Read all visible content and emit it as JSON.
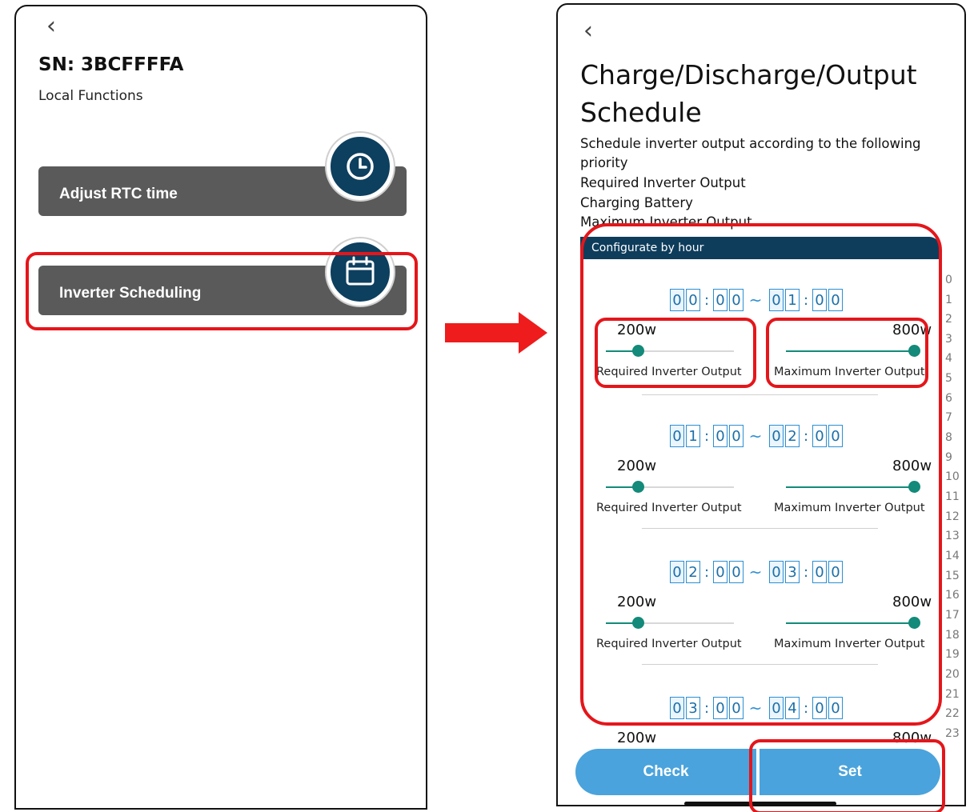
{
  "left_screen": {
    "back_symbol": "‹",
    "serial_title": "SN: 3BCFFFFA",
    "subtitle": "Local Functions",
    "cards": [
      {
        "label": "Adjust RTC time",
        "icon": "clock-icon"
      },
      {
        "label": "Inverter Scheduling",
        "icon": "calendar-icon"
      }
    ]
  },
  "arrow": {
    "color": "#ee1c1c",
    "icon": "right-arrow-icon"
  },
  "right_screen": {
    "back_symbol": "‹",
    "title": "Charge/Discharge/Output Schedule",
    "description_lines": [
      "Schedule inverter output according to the following",
      "priority",
      "Required Inverter Output",
      "Charging Battery",
      "Maximum Inverter Output"
    ],
    "configure_tab": "Configurate by hour",
    "slots": [
      {
        "start_h": [
          "0",
          "0"
        ],
        "start_m": [
          "0",
          "0"
        ],
        "end_h": [
          "0",
          "1"
        ],
        "end_m": [
          "0",
          "0"
        ],
        "required": "200w",
        "maximum": "800w",
        "required_label": "Required Inverter Output",
        "maximum_label": "Maximum Inverter Output",
        "required_level": 0.25,
        "maximum_level": 1.0
      },
      {
        "start_h": [
          "0",
          "1"
        ],
        "start_m": [
          "0",
          "0"
        ],
        "end_h": [
          "0",
          "2"
        ],
        "end_m": [
          "0",
          "0"
        ],
        "required": "200w",
        "maximum": "800w",
        "required_label": "Required Inverter Output",
        "maximum_label": "Maximum Inverter Output",
        "required_level": 0.25,
        "maximum_level": 1.0
      },
      {
        "start_h": [
          "0",
          "2"
        ],
        "start_m": [
          "0",
          "0"
        ],
        "end_h": [
          "0",
          "3"
        ],
        "end_m": [
          "0",
          "0"
        ],
        "required": "200w",
        "maximum": "800w",
        "required_label": "Required Inverter Output",
        "maximum_label": "Maximum Inverter Output",
        "required_level": 0.25,
        "maximum_level": 1.0
      },
      {
        "start_h": [
          "0",
          "3"
        ],
        "start_m": [
          "0",
          "0"
        ],
        "end_h": [
          "0",
          "4"
        ],
        "end_m": [
          "0",
          "0"
        ],
        "required": "200w",
        "maximum": "800w"
      }
    ],
    "hour_index": [
      "0",
      "1",
      "2",
      "3",
      "4",
      "5",
      "6",
      "7",
      "8",
      "9",
      "10",
      "11",
      "12",
      "13",
      "14",
      "15",
      "16",
      "17",
      "18",
      "19",
      "20",
      "21",
      "22",
      "23"
    ],
    "check_label": "Check",
    "set_label": "Set"
  },
  "colors": {
    "card_gray": "#5a5a5a",
    "badge_navy": "#0d3f5f",
    "slider_green": "#138a7a",
    "digit_blue": "#2b8fd2",
    "button_blue": "#4aa3dc",
    "highlight_red": "#e4161b"
  }
}
